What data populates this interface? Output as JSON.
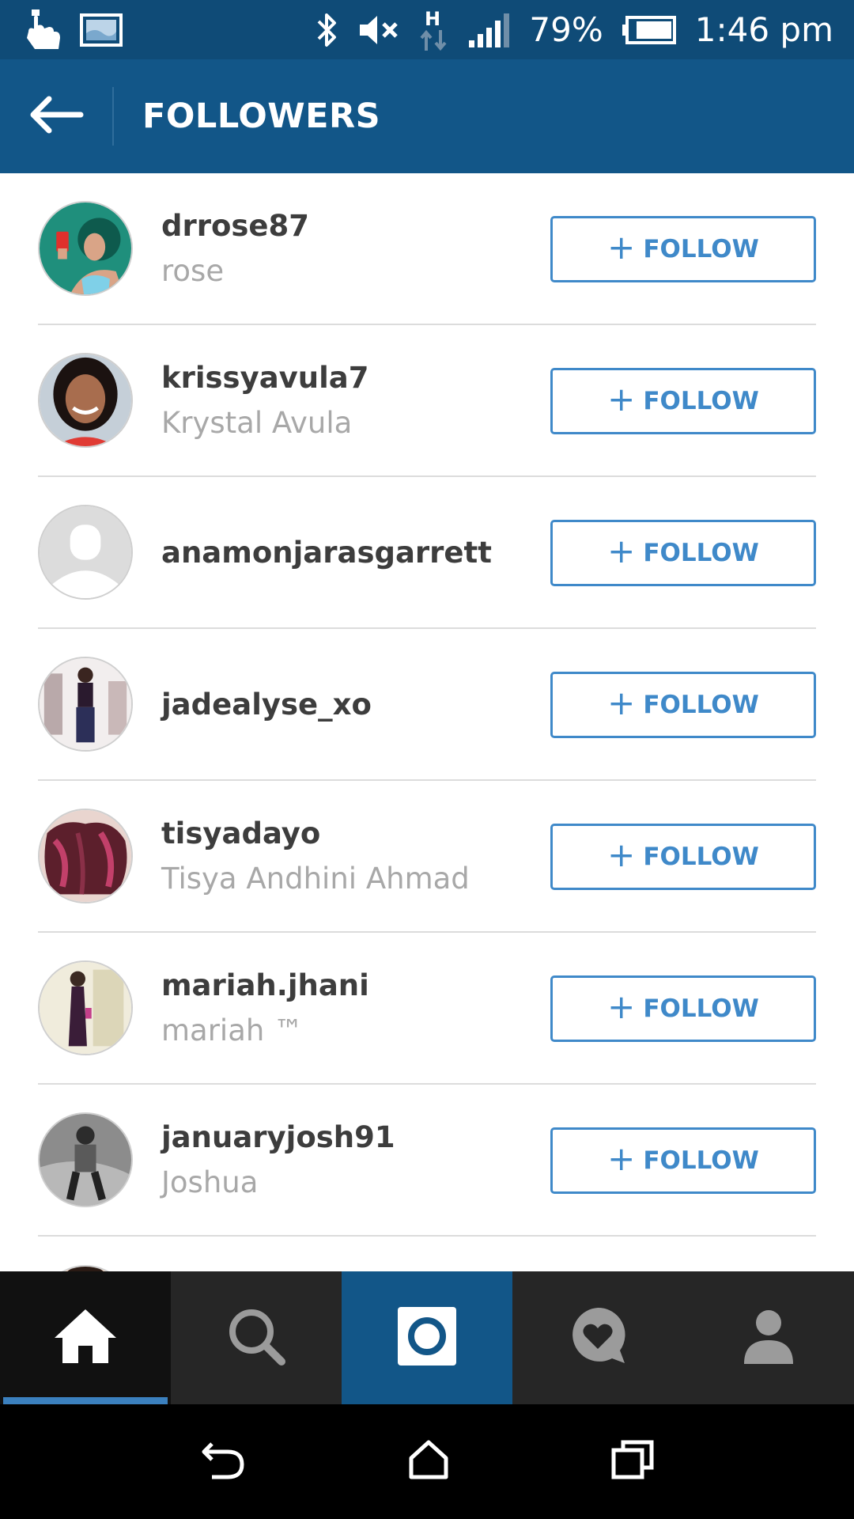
{
  "status_bar": {
    "battery": "79%",
    "time": "1:46 pm",
    "network_label": "H"
  },
  "header": {
    "title": "FOLLOWERS"
  },
  "followers": [
    {
      "username": "drrose87",
      "full_name": "rose"
    },
    {
      "username": "krissyavula7",
      "full_name": "Krystal Avula"
    },
    {
      "username": "anamonjarasgarrett",
      "full_name": ""
    },
    {
      "username": "jadealyse_xo",
      "full_name": ""
    },
    {
      "username": "tisyadayo",
      "full_name": "Tisya Andhini Ahmad"
    },
    {
      "username": "mariah.jhani",
      "full_name": "mariah ™"
    },
    {
      "username": "januaryjosh91",
      "full_name": "Joshua"
    }
  ],
  "follow_label": "FOLLOW",
  "follow_plus": "+",
  "tabs": [
    "home-icon",
    "search-icon",
    "camera-icon",
    "activity-icon",
    "profile-icon"
  ],
  "colors": {
    "header": "#125688",
    "status_bar": "#0f4b77",
    "accent": "#3f89c9",
    "tabbar": "#262626"
  }
}
